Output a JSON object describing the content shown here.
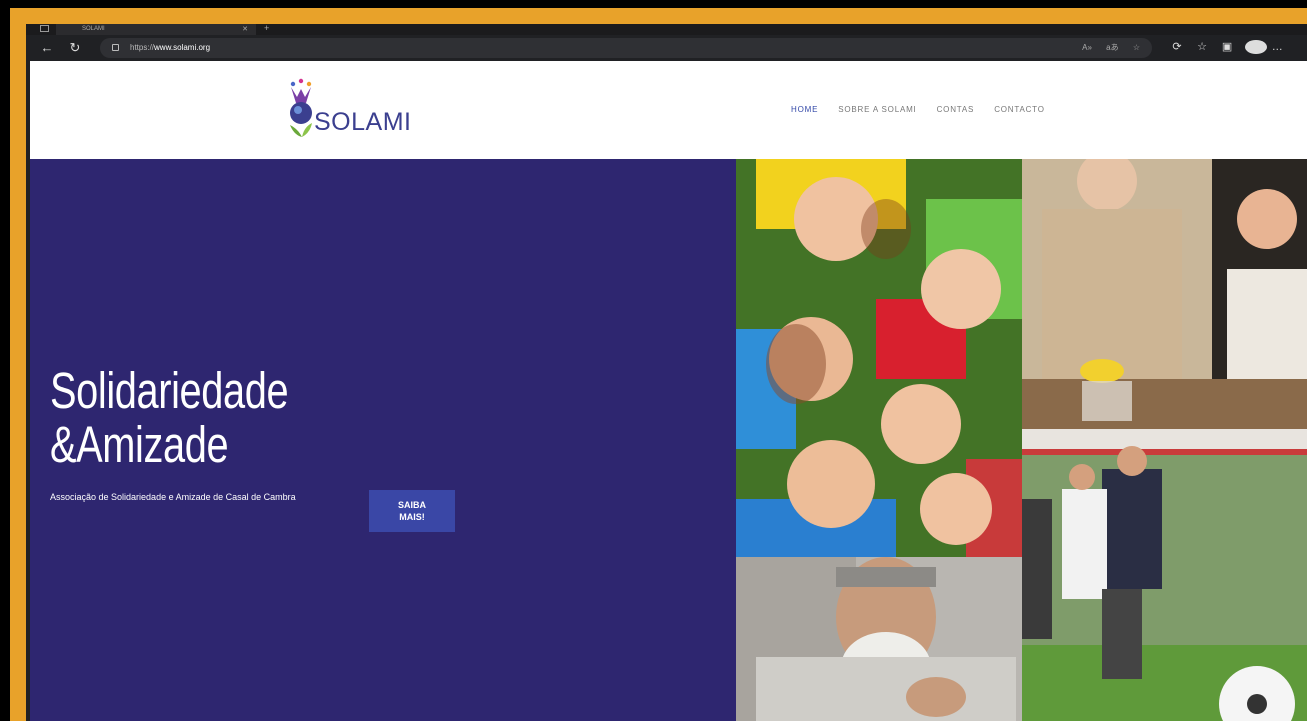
{
  "browser": {
    "tab_title": "SOLAMI",
    "url_prefix": "https://",
    "url_host": "www.solami.org",
    "back_icon": "back-arrow-icon",
    "refresh_icon": "refresh-icon"
  },
  "site": {
    "logo_text": "SOLAMI",
    "nav": [
      "HOME",
      "SOBRE A SOLAMI",
      "CONTAS",
      "CONTACTO"
    ],
    "active_nav": "HOME"
  },
  "hero": {
    "title_line1": "Solidariedade",
    "title_line2": "&Amizade",
    "subtitle": "Associação de Solidariedade e Amizade de Casal de Cambra",
    "button_line1": "SAIBA",
    "button_line2": "MAIS!"
  },
  "colors": {
    "frame": "#e8a22a",
    "hero_bg": "#2e2670",
    "button_bg": "#3a47a6",
    "nav_active": "#3348a8"
  }
}
